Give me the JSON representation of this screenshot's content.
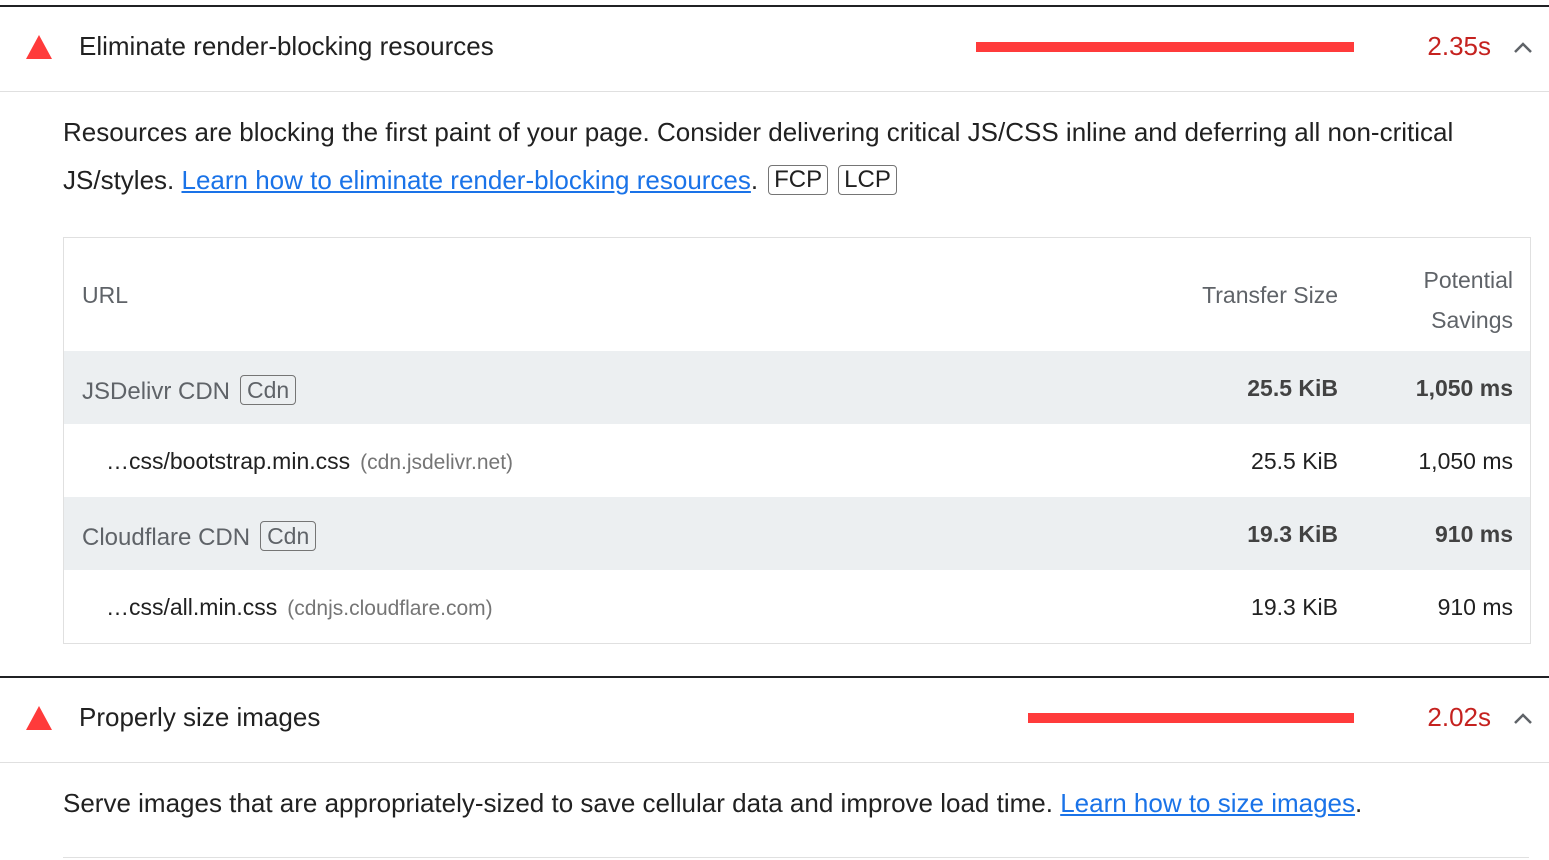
{
  "audits": [
    {
      "title": "Eliminate render-blocking resources",
      "savings": "2.35s",
      "savings_fraction": 0.98,
      "description_text": "Resources are blocking the first paint of your page. Consider delivering critical JS/CSS inline and deferring all non-critical JS/styles. ",
      "description_link": "Learn how to eliminate render-blocking resources",
      "description_end": ".",
      "chips": [
        "FCP",
        "LCP"
      ],
      "table": {
        "columns": {
          "url": "URL",
          "transfer_size": "Transfer Size",
          "savings_line1": "Potential",
          "savings_line2": "Savings"
        },
        "groups": [
          {
            "name": "JSDelivr CDN",
            "tag": "Cdn",
            "transfer_size": "25.5 KiB",
            "savings": "1,050 ms",
            "item": {
              "url": "…css/bootstrap.min.css",
              "host": "(cdn.jsdelivr.net)",
              "transfer_size": "25.5 KiB",
              "savings": "1,050 ms"
            }
          },
          {
            "name": "Cloudflare CDN",
            "tag": "Cdn",
            "transfer_size": "19.3 KiB",
            "savings": "910 ms",
            "item": {
              "url": "…css/all.min.css",
              "host": "(cdnjs.cloudflare.com)",
              "transfer_size": "19.3 KiB",
              "savings": "910 ms"
            }
          }
        ]
      }
    },
    {
      "title": "Properly size images",
      "savings": "2.02s",
      "savings_fraction": 0.84,
      "description_text": "Serve images that are appropriately-sized to save cellular data and improve load time. ",
      "description_link": "Learn how to size images",
      "description_end": "."
    }
  ],
  "colors": {
    "fail": "#ff3b3b",
    "fail_text": "#c5221f",
    "link": "#1a73e8",
    "group_bg": "#eceff1"
  },
  "icons": {
    "fail": "warning-triangle-icon",
    "toggle": "chevron-up-icon"
  }
}
